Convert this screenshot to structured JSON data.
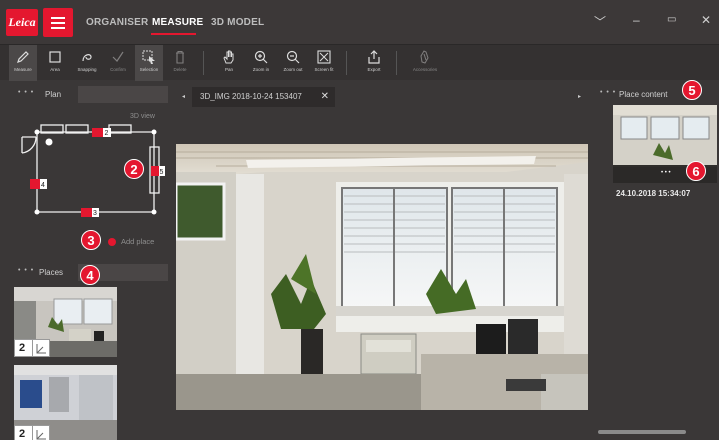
{
  "app": {
    "logo_text": "Leica",
    "nav": [
      "ORGANISER",
      "MEASURE",
      "3D MODEL"
    ],
    "active_tab": "MEASURE",
    "accent_color": "#e4172f"
  },
  "toolbar": {
    "tools": [
      {
        "label": "Measure",
        "icon": "pencil-icon"
      },
      {
        "label": "Area",
        "icon": "area-square-icon"
      },
      {
        "label": "Snapping",
        "icon": "snapping-icon"
      },
      {
        "label": "Confirm",
        "icon": "check-icon"
      },
      {
        "label": "Selection",
        "icon": "selection-cursor-icon"
      },
      {
        "label": "Delete",
        "icon": "trash-icon"
      },
      {
        "label": "Pan",
        "icon": "hand-icon"
      },
      {
        "label": "Zoom in",
        "icon": "zoom-in-icon"
      },
      {
        "label": "Zoom out",
        "icon": "zoom-out-icon"
      },
      {
        "label": "Screen fit",
        "icon": "screen-fit-icon"
      },
      {
        "label": "Export",
        "icon": "export-icon"
      },
      {
        "label": "Accessories",
        "icon": "accessories-icon"
      }
    ]
  },
  "plan": {
    "title": "Plan",
    "view_label": "3D view",
    "add_place": "Add place",
    "marker_labels": [
      "2",
      "5",
      "4",
      "3"
    ]
  },
  "places": {
    "title": "Places",
    "items": [
      {
        "count": "2"
      },
      {
        "count": "2"
      }
    ]
  },
  "viewer": {
    "tab_title": "3D_IMG 2018-10-24 153407",
    "close": "✕",
    "prev": "◂",
    "next": "▸"
  },
  "place_content": {
    "title": "Place content",
    "more": "• • •",
    "date": "24.10.2018 15:34:07"
  },
  "callouts": [
    "2",
    "3",
    "4",
    "5",
    "6"
  ],
  "window_controls": [
    "﹀",
    "–",
    "▭",
    "✕"
  ]
}
